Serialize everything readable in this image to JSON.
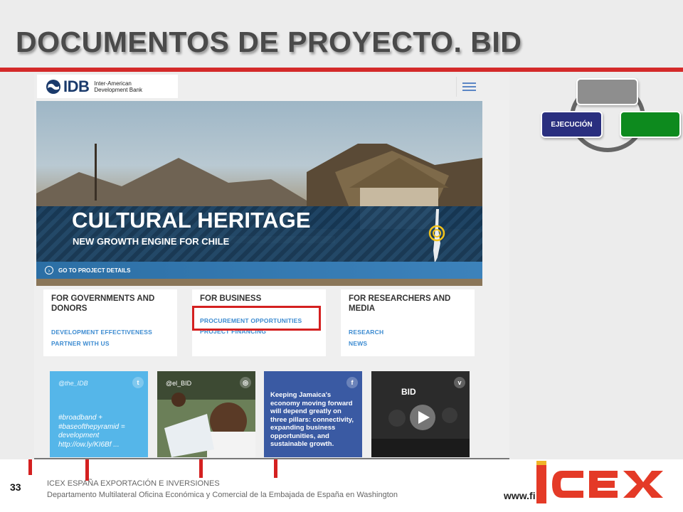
{
  "slide": {
    "title": "DOCUMENTOS DE PROYECTO. BID",
    "page_number": "33",
    "footer_line1": "ICEX ESPAÑA EXPORTACIÓN  E INVERSIONES",
    "footer_line2": "Departamento Multilateral Oficina Económica y Comercial de la Embajada de España en Washington",
    "footer_url": "www.fi",
    "icex_logo_text": "ICEX"
  },
  "cycle": {
    "active_label": "EJECUCIÓN",
    "colors": {
      "top": "#8e8e8e",
      "active": "#2a2f7f",
      "right": "#0d8a1e",
      "ring": "#666666"
    }
  },
  "idb": {
    "logo_abbr": "IDB",
    "logo_name_line1": "Inter-American",
    "logo_name_line2": "Development Bank",
    "hero_title": "CULTURAL HERITAGE",
    "hero_subtitle": "NEW GROWTH ENGINE FOR CHILE",
    "hero_link": "GO TO PROJECT DETAILS",
    "cards": [
      {
        "title": "FOR GOVERNMENTS AND DONORS",
        "links": [
          "DEVELOPMENT EFFECTIVENESS",
          "PARTNER WITH US"
        ]
      },
      {
        "title": "FOR BUSINESS",
        "links": [
          "PROCUREMENT OPPORTUNITIES",
          "PROJECT FINANCING"
        ]
      },
      {
        "title": "FOR RESEARCHERS AND MEDIA",
        "links": [
          "RESEARCH",
          "NEWS"
        ]
      }
    ],
    "social": {
      "twitter_handle": "@the_IDB",
      "twitter_text": "#broadband + #baseofthepyramid = development http://ow.ly/KI6Bf ...",
      "instagram_handle": "@el_BID",
      "facebook_text": "Keeping Jamaica's economy moving forward will depend greatly on three pillars: connectivity, expanding business opportunities, and sustainable growth.",
      "vimeo_logo": "BID"
    },
    "accent_colors": {
      "link": "#3c8bd1",
      "highlight": "#d42020",
      "band": "#103454"
    }
  }
}
